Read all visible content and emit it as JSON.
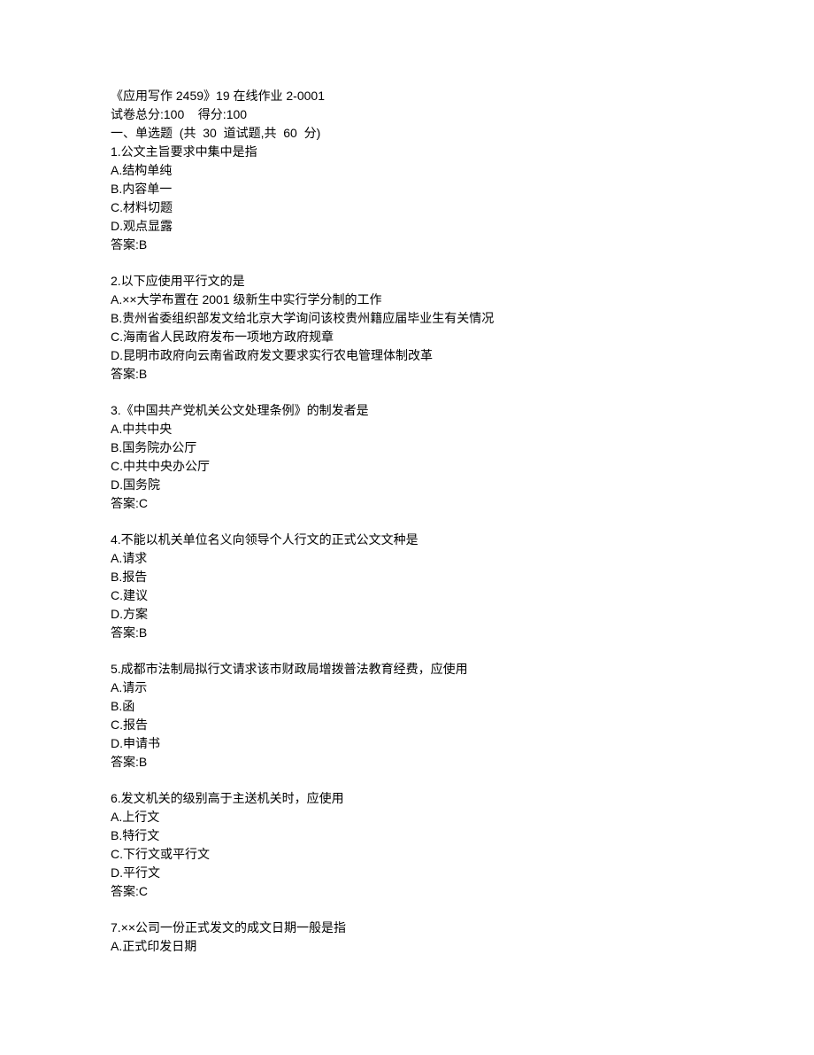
{
  "header": {
    "title": "《应用写作 2459》19 在线作业 2-0001",
    "score_line": "试卷总分:100    得分:100",
    "section_title": "一、单选题  (共  30  道试题,共  60  分)"
  },
  "questions": [
    {
      "stem": "1.公文主旨要求中集中是指",
      "options": [
        "A.结构单纯",
        "B.内容单一",
        "C.材料切题",
        "D.观点显露"
      ],
      "answer": "答案:B"
    },
    {
      "stem": "2.以下应使用平行文的是",
      "options": [
        "A.××大学布置在 2001 级新生中实行学分制的工作",
        "B.贵州省委组织部发文给北京大学询问该校贵州籍应届毕业生有关情况",
        "C.海南省人民政府发布一项地方政府规章",
        "D.昆明市政府向云南省政府发文要求实行农电管理体制改革"
      ],
      "answer": "答案:B"
    },
    {
      "stem": "3.《中国共产党机关公文处理条例》的制发者是",
      "options": [
        "A.中共中央",
        "B.国务院办公厅",
        "C.中共中央办公厅",
        "D.国务院"
      ],
      "answer": "答案:C"
    },
    {
      "stem": "4.不能以机关单位名义向领导个人行文的正式公文文种是",
      "options": [
        "A.请求",
        "B.报告",
        "C.建议",
        "D.方案"
      ],
      "answer": "答案:B"
    },
    {
      "stem": "5.成都市法制局拟行文请求该市财政局增拨普法教育经费，应使用",
      "options": [
        "A.请示",
        "B.函",
        "C.报告",
        "D.申请书"
      ],
      "answer": "答案:B"
    },
    {
      "stem": "6.发文机关的级别高于主送机关时，应使用",
      "options": [
        "A.上行文",
        "B.特行文",
        "C.下行文或平行文",
        "D.平行文"
      ],
      "answer": "答案:C"
    },
    {
      "stem": "7.××公司一份正式发文的成文日期一般是指",
      "options": [
        "A.正式印发日期"
      ],
      "answer": ""
    }
  ]
}
